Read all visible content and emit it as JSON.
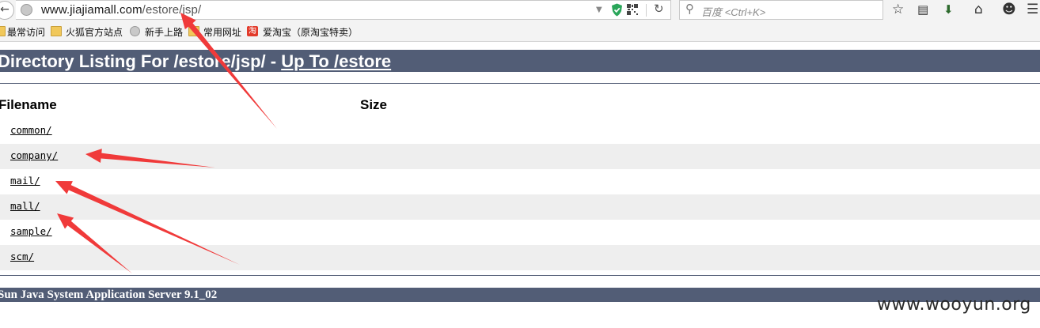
{
  "browser": {
    "url": {
      "host": "www.jiajiamall.com",
      "path": "/estore/jsp/"
    },
    "search_placeholder": "百度 <Ctrl+K>",
    "bookmarks": [
      {
        "label": "最常访问",
        "icon": "bookmark-folder-icon"
      },
      {
        "label": "火狐官方站点",
        "icon": "folder-icon"
      },
      {
        "label": "新手上路",
        "icon": "globe-icon"
      },
      {
        "label": "常用网址",
        "icon": "folder-icon"
      },
      {
        "label": "爱淘宝（原淘宝特卖）",
        "icon": "taobao-icon"
      }
    ],
    "taobao_glyph": "淘",
    "icons": [
      "back-icon",
      "globe-icon",
      "dropdown-icon",
      "shield-icon",
      "qr-code-icon",
      "reload-icon",
      "search-icon",
      "star-icon",
      "reading-list-icon",
      "download-icon",
      "home-icon",
      "smiley-icon",
      "menu-icon"
    ]
  },
  "page": {
    "title_prefix": "Directory Listing For /estore/jsp/ - ",
    "title_link": "Up To /estore",
    "columns": {
      "filename": "Filename",
      "size": "Size"
    },
    "entries": [
      "common/",
      "company/",
      "mail/",
      "mall/",
      "sample/",
      "scm/"
    ],
    "footer": "Sun Java System Application Server 9.1_02"
  },
  "annotation_color": "#f03a3a",
  "watermark": "www.wooyun.org"
}
